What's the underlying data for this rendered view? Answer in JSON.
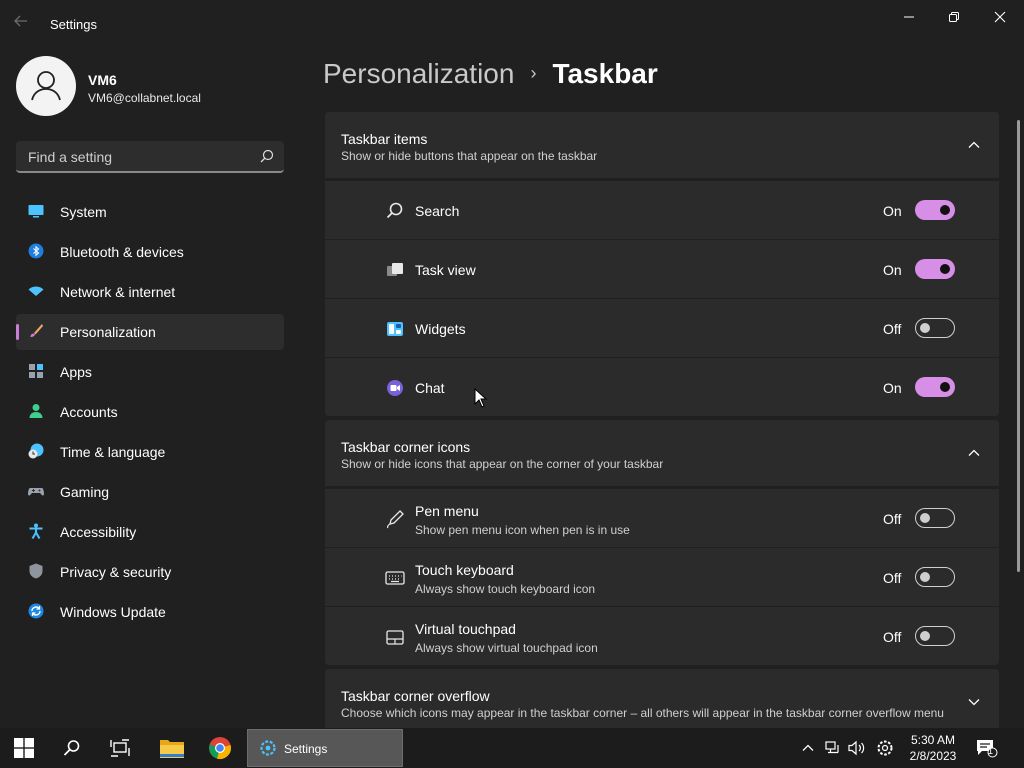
{
  "window": {
    "title": "Settings",
    "back_icon": "arrow-left-icon"
  },
  "profile": {
    "name": "VM6",
    "email": "VM6@collabnet.local"
  },
  "search": {
    "placeholder": "Find a setting",
    "value": ""
  },
  "nav": {
    "items": [
      {
        "label": "System",
        "icon": "monitor-icon"
      },
      {
        "label": "Bluetooth & devices",
        "icon": "bluetooth-icon"
      },
      {
        "label": "Network & internet",
        "icon": "wifi-icon"
      },
      {
        "label": "Personalization",
        "icon": "brush-icon",
        "active": true
      },
      {
        "label": "Apps",
        "icon": "apps-icon"
      },
      {
        "label": "Accounts",
        "icon": "person-icon"
      },
      {
        "label": "Time & language",
        "icon": "clock-globe-icon"
      },
      {
        "label": "Gaming",
        "icon": "gamepad-icon"
      },
      {
        "label": "Accessibility",
        "icon": "accessibility-icon"
      },
      {
        "label": "Privacy & security",
        "icon": "shield-icon"
      },
      {
        "label": "Windows Update",
        "icon": "update-icon"
      }
    ]
  },
  "breadcrumb": {
    "parent": "Personalization",
    "separator": "›",
    "current": "Taskbar"
  },
  "sections": {
    "taskbar_items": {
      "title": "Taskbar items",
      "subtitle": "Show or hide buttons that appear on the taskbar",
      "rows": [
        {
          "label": "Search",
          "state": "On",
          "on": true,
          "icon": "search-icon"
        },
        {
          "label": "Task view",
          "state": "On",
          "on": true,
          "icon": "task-view-icon"
        },
        {
          "label": "Widgets",
          "state": "Off",
          "on": false,
          "icon": "widgets-icon"
        },
        {
          "label": "Chat",
          "state": "On",
          "on": true,
          "icon": "chat-icon"
        }
      ]
    },
    "corner_icons": {
      "title": "Taskbar corner icons",
      "subtitle": "Show or hide icons that appear on the corner of your taskbar",
      "rows": [
        {
          "label": "Pen menu",
          "sub": "Show pen menu icon when pen is in use",
          "state": "Off",
          "on": false,
          "icon": "pen-icon"
        },
        {
          "label": "Touch keyboard",
          "sub": "Always show touch keyboard icon",
          "state": "Off",
          "on": false,
          "icon": "keyboard-icon"
        },
        {
          "label": "Virtual touchpad",
          "sub": "Always show virtual touchpad icon",
          "state": "Off",
          "on": false,
          "icon": "touchpad-icon"
        }
      ]
    },
    "corner_overflow": {
      "title": "Taskbar corner overflow",
      "subtitle": "Choose which icons may appear in the taskbar corner – all others will appear in the taskbar corner overflow menu"
    }
  },
  "taskbar": {
    "active_app": "Settings",
    "time": "5:30 AM",
    "date": "2/8/2023",
    "notification_count": "1"
  },
  "colors": {
    "accent": "#d78ee6",
    "background": "#202020",
    "card": "#2b2b2b"
  }
}
